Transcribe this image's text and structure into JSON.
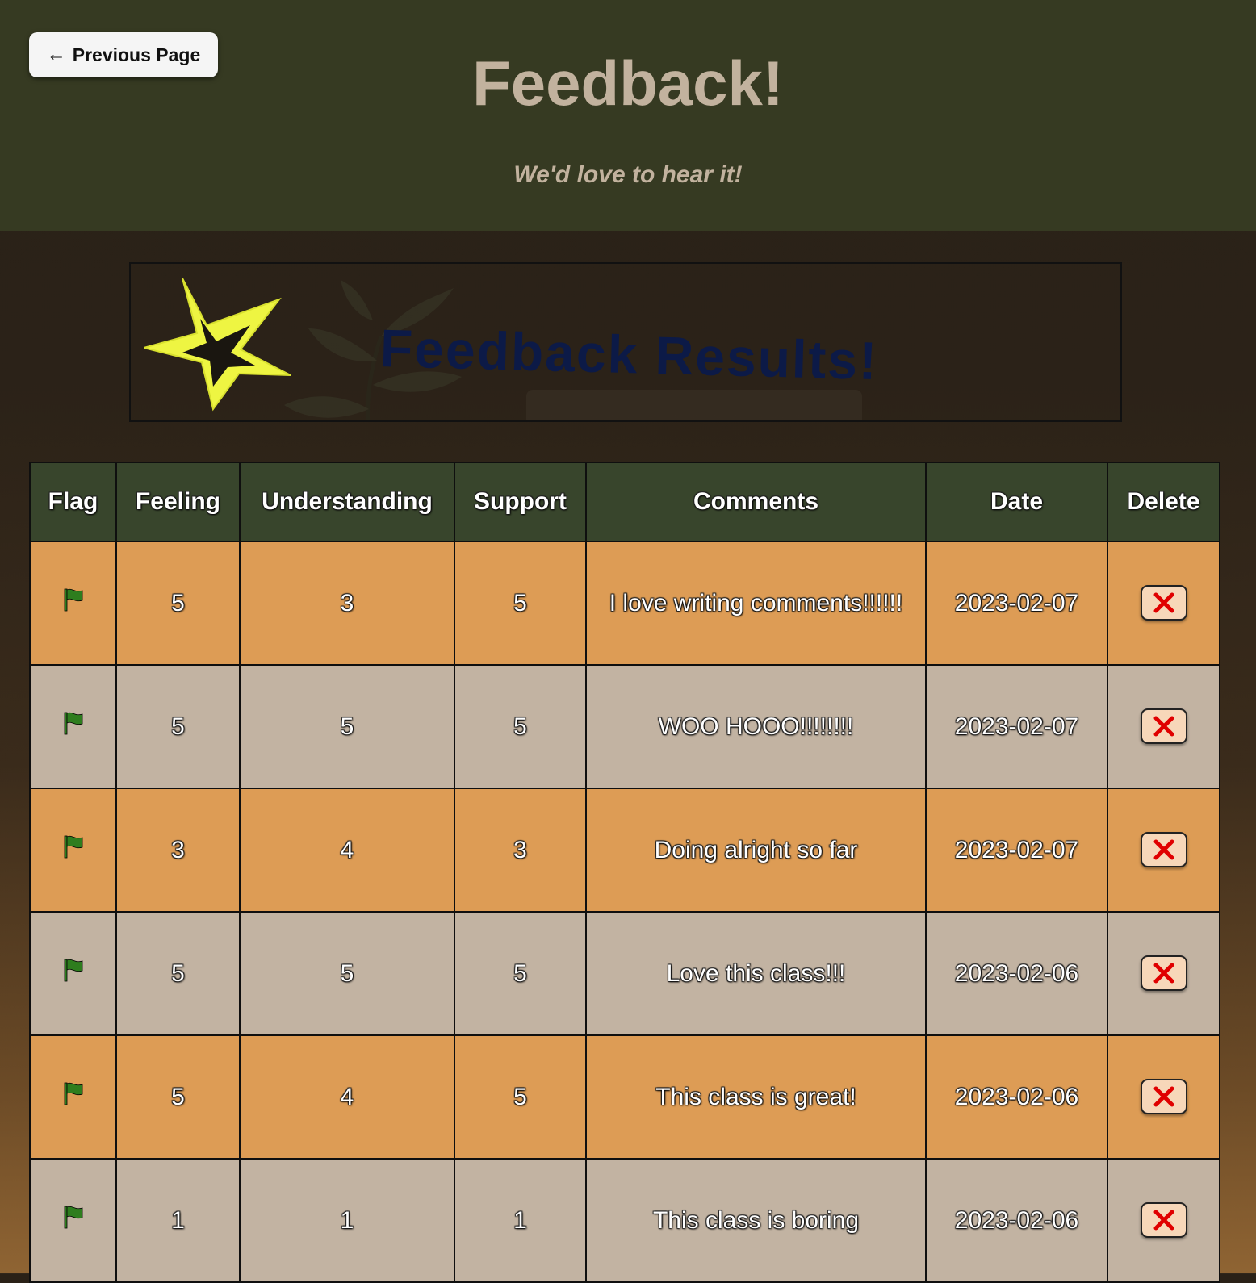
{
  "header": {
    "back_button_label": "Previous Page",
    "title": "Feedback!",
    "subtitle": "We'd love to hear it!"
  },
  "banner": {
    "title": "Feedback Results!"
  },
  "table": {
    "columns": [
      "Flag",
      "Feeling",
      "Understanding",
      "Support",
      "Comments",
      "Date",
      "Delete"
    ],
    "rows": [
      {
        "feeling": "5",
        "understanding": "3",
        "support": "5",
        "comments": "I love writing comments!!!!!!",
        "date": "2023-02-07"
      },
      {
        "feeling": "5",
        "understanding": "5",
        "support": "5",
        "comments": "WOO HOOO!!!!!!!!",
        "date": "2023-02-07"
      },
      {
        "feeling": "3",
        "understanding": "4",
        "support": "3",
        "comments": "Doing alright so far",
        "date": "2023-02-07"
      },
      {
        "feeling": "5",
        "understanding": "5",
        "support": "5",
        "comments": "Love this class!!!",
        "date": "2023-02-06"
      },
      {
        "feeling": "5",
        "understanding": "4",
        "support": "5",
        "comments": "This class is great!",
        "date": "2023-02-06"
      },
      {
        "feeling": "1",
        "understanding": "1",
        "support": "1",
        "comments": "This class is boring",
        "date": "2023-02-06"
      }
    ]
  },
  "icons": {
    "back": "arrow-left-icon",
    "flag": "flag-icon",
    "delete": "close-x-icon",
    "banner": "star-icon"
  },
  "colors": {
    "header_bg": "#363a22",
    "title_text": "#c2b29e",
    "table_header_bg": "#38452c",
    "row_orange": "#dd9c55",
    "row_tan": "#c2b3a2",
    "flag_green": "#2e7d1e",
    "delete_red": "#e00000",
    "star_yellow": "#eef542",
    "banner_title": "#0c1a47"
  }
}
